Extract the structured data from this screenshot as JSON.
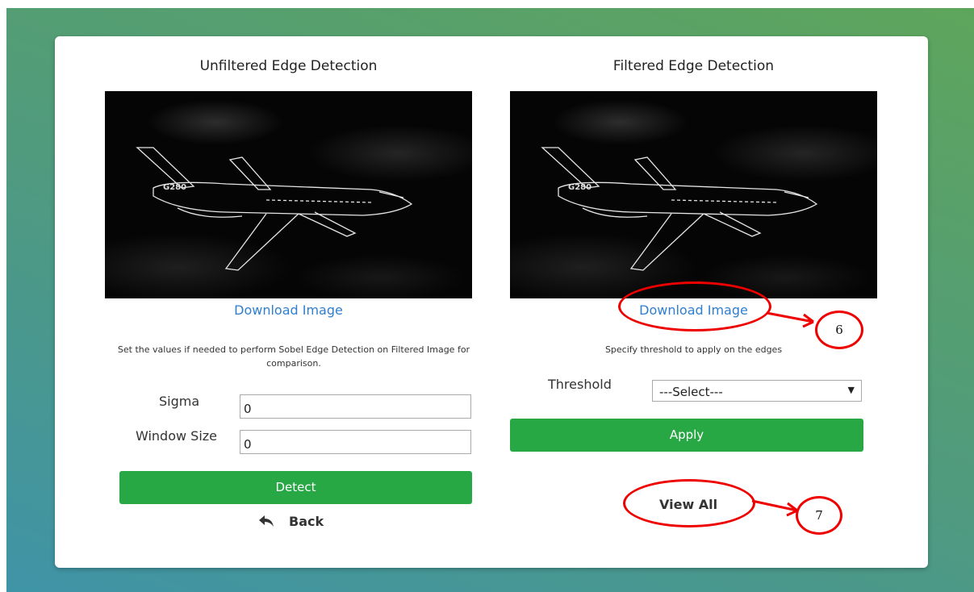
{
  "left_panel": {
    "title": "Unfiltered Edge Detection",
    "download_label": "Download Image",
    "hint": "Set the values if needed to perform Sobel Edge Detection on Filtered Image for comparison.",
    "sigma_label": "Sigma",
    "sigma_value": "0",
    "window_size_label": "Window Size",
    "window_size_value": "0",
    "detect_label": "Detect",
    "back_label": "Back"
  },
  "right_panel": {
    "title": "Filtered Edge Detection",
    "download_label": "Download Image",
    "hint": "Specify threshold to apply on the edges",
    "threshold_label": "Threshold",
    "threshold_selected": "---Select---",
    "apply_label": "Apply",
    "view_all_label": "View All"
  },
  "annotations": {
    "marker_6": "6",
    "marker_7": "7"
  },
  "images": {
    "plane_marking": "G280"
  },
  "colors": {
    "accent_green": "#28a745",
    "link_blue": "#2f7fcf",
    "annotation_red": "#e00000"
  },
  "icons": {
    "back": "reply-arrow-icon",
    "select_arrow": "caret-down-icon"
  }
}
